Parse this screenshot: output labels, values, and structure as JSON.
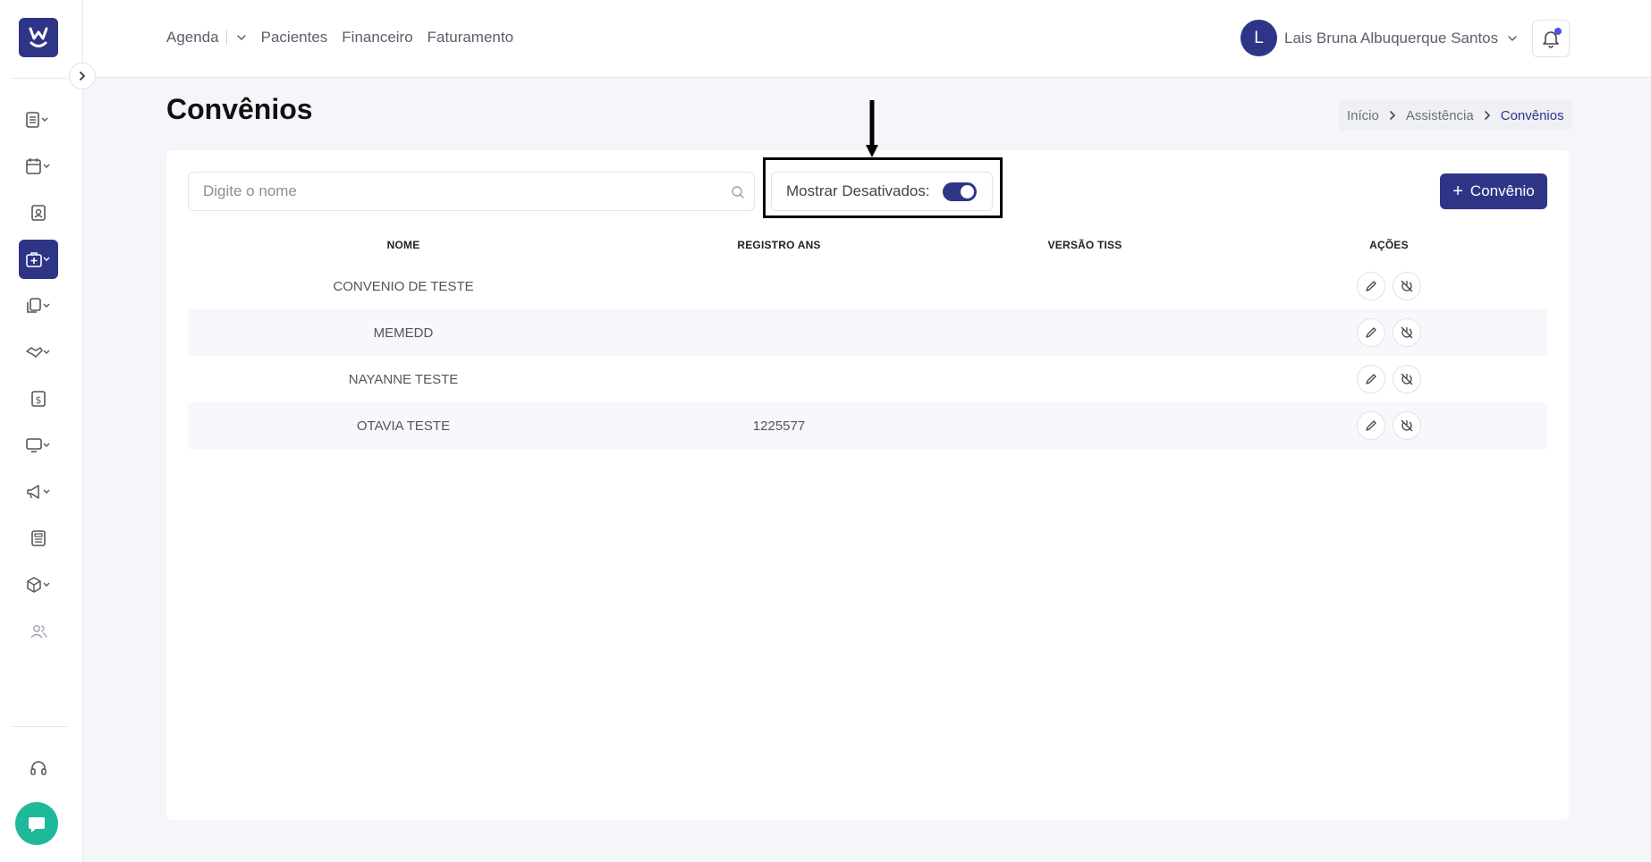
{
  "topnav": {
    "agenda": "Agenda",
    "pacientes": "Pacientes",
    "financeiro": "Financeiro",
    "faturamento": "Faturamento"
  },
  "user": {
    "initial": "L",
    "name": "Lais Bruna Albuquerque Santos"
  },
  "page": {
    "title": "Convênios"
  },
  "breadcrumb": {
    "home": "Início",
    "section": "Assistência",
    "current": "Convênios"
  },
  "search": {
    "placeholder": "Digite o nome",
    "value": ""
  },
  "toggle": {
    "label": "Mostrar Desativados:",
    "on": true
  },
  "add_button": {
    "label": "Convênio"
  },
  "table": {
    "headers": [
      "NOME",
      "REGISTRO ANS",
      "VERSÃO TISS",
      "AÇÕES"
    ],
    "rows": [
      {
        "nome": "CONVENIO DE TESTE",
        "registro_ans": "",
        "versao_tiss": ""
      },
      {
        "nome": "MEMEDD",
        "registro_ans": "",
        "versao_tiss": ""
      },
      {
        "nome": "NAYANNE TESTE",
        "registro_ans": "",
        "versao_tiss": ""
      },
      {
        "nome": "OTAVIA TESTE",
        "registro_ans": "1225577",
        "versao_tiss": ""
      }
    ]
  },
  "colors": {
    "primary": "#2e3587",
    "chat": "#1fb99a",
    "notification_dot": "#4a56e2"
  },
  "icons": {
    "sidebar": [
      "clipboard-list-icon",
      "calendar-icon",
      "patient-card-icon",
      "medical-bag-icon",
      "documents-icon",
      "handshake-icon",
      "dollar-icon",
      "monitor-icon",
      "megaphone-icon",
      "newspaper-icon",
      "package-icon",
      "users-icon",
      "headset-icon"
    ]
  }
}
